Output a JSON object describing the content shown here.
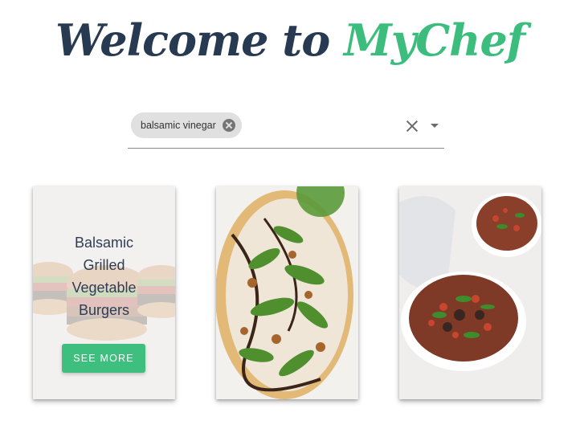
{
  "header": {
    "title_part1": "Welcome to",
    "title_part2": "MyChef"
  },
  "search": {
    "chips": [
      {
        "label": "balsamic vinegar"
      }
    ]
  },
  "recipes": [
    {
      "title": "Balsamic Grilled Vegetable Burgers",
      "button_label": "SEE MORE",
      "image": "veggie-burgers-photo"
    },
    {
      "image": "arugula-flatbread-pizza-photo"
    },
    {
      "image": "vegetable-stew-bowls-photo"
    }
  ],
  "colors": {
    "title_dark": "#273a52",
    "title_accent": "#3dbd7d",
    "button": "#3fbf7f"
  }
}
